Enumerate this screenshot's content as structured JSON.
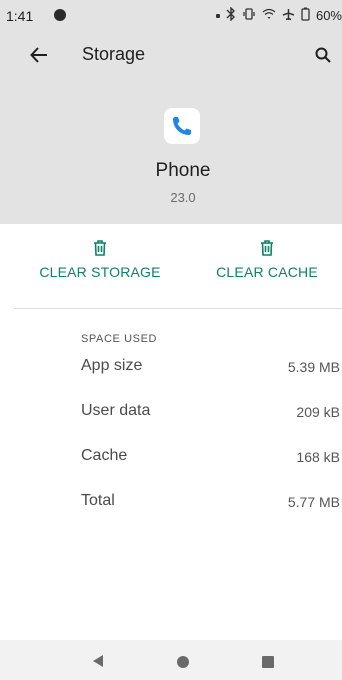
{
  "status_bar": {
    "time": "1:41",
    "battery": "60%"
  },
  "toolbar": {
    "title": "Storage"
  },
  "app": {
    "name": "Phone",
    "version": "23.0"
  },
  "actions": {
    "clear_storage": "CLEAR STORAGE",
    "clear_cache": "CLEAR CACHE"
  },
  "space_used": {
    "header": "SPACE USED",
    "rows": [
      {
        "label": "App size",
        "value": "5.39 MB"
      },
      {
        "label": "User data",
        "value": "209 kB"
      },
      {
        "label": "Cache",
        "value": "168 kB"
      },
      {
        "label": "Total",
        "value": "5.77 MB"
      }
    ]
  },
  "colors": {
    "accent": "#0f8069",
    "header_bg": "#e3e3e3",
    "phone_icon": "#1e88e5"
  },
  "icons": [
    "back-arrow-icon",
    "search-icon",
    "phone-icon",
    "trash-icon",
    "nav-back-icon",
    "nav-home-icon",
    "nav-recents-icon"
  ]
}
